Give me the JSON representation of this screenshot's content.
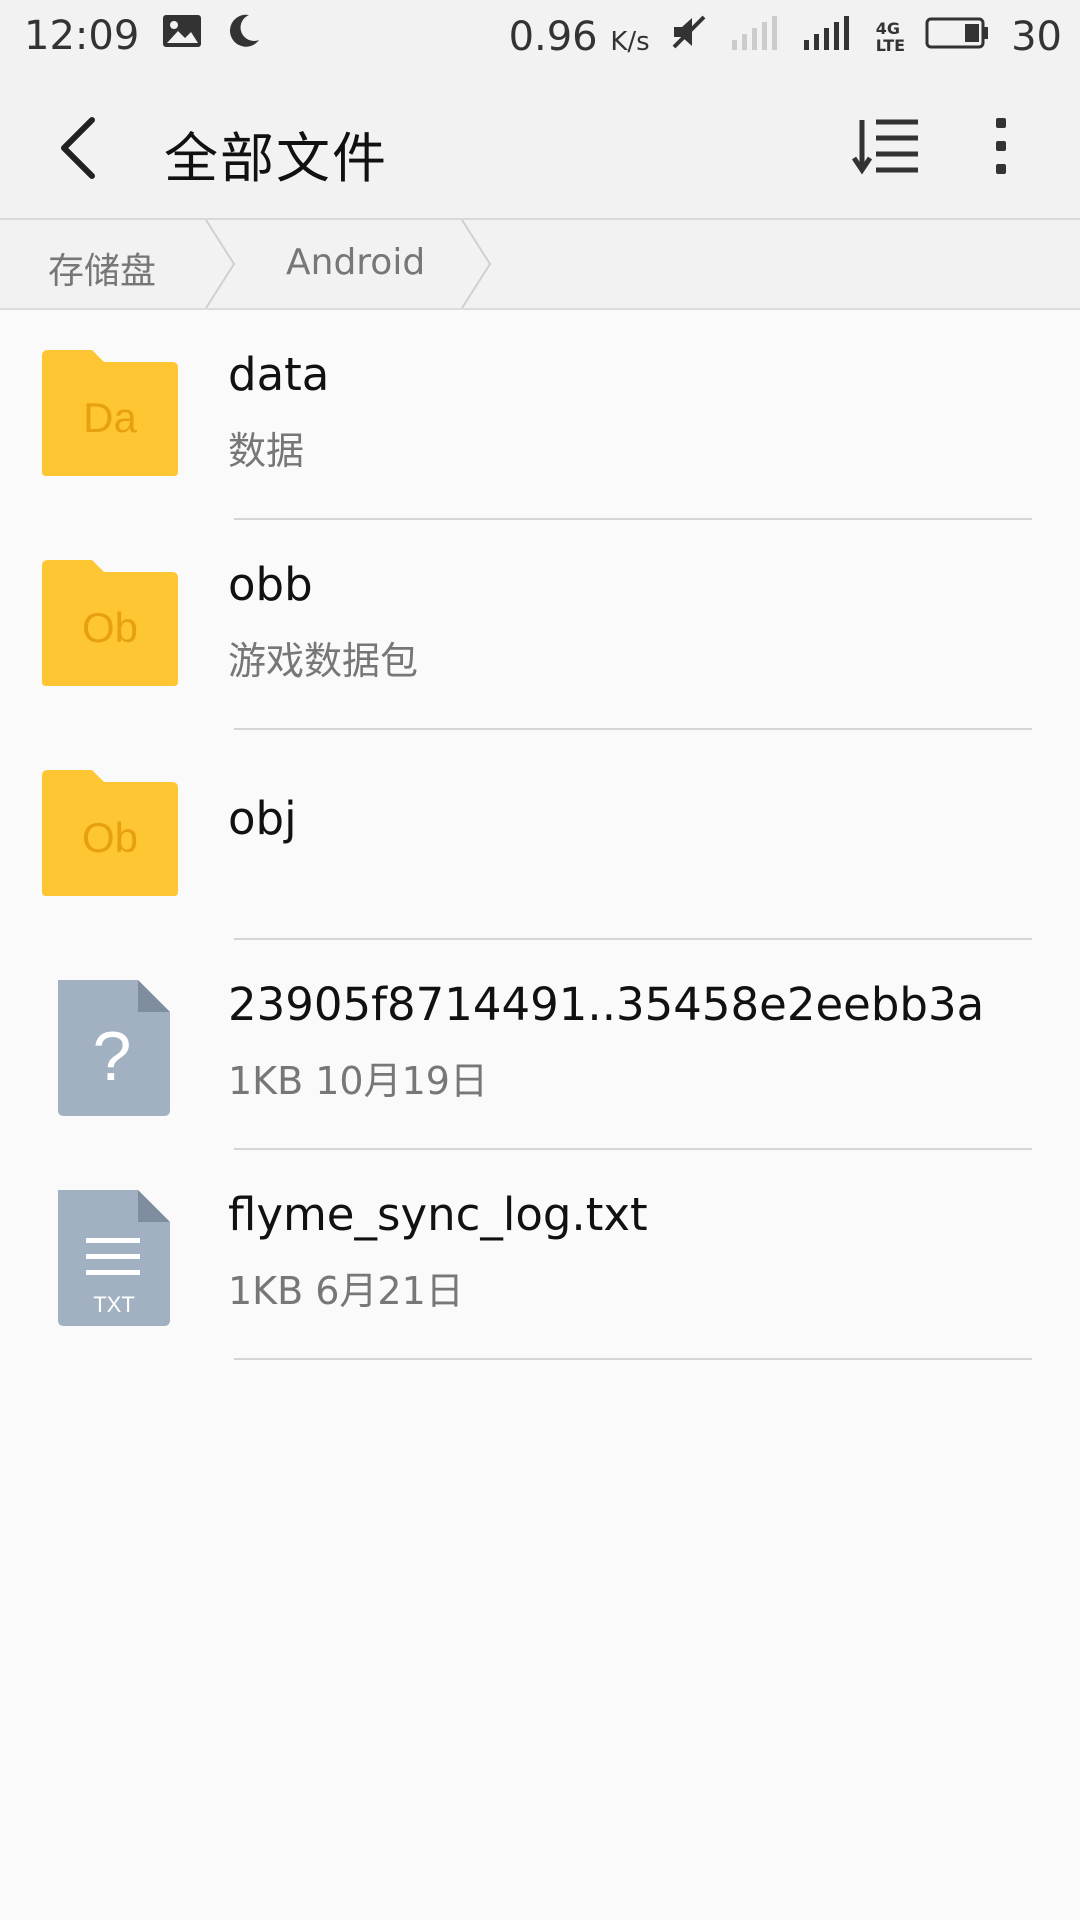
{
  "status_bar": {
    "time": "12:09",
    "net_speed": "0.96",
    "net_unit": "K/s",
    "network_label_top": "4G",
    "network_label_bottom": "LTE",
    "battery_level": "30",
    "icons": [
      "image-icon",
      "moon-icon",
      "mute-icon",
      "signal-empty-icon",
      "signal-full-icon",
      "battery-icon"
    ]
  },
  "app_bar": {
    "title": "全部文件",
    "back_icon": "chevron-left-icon",
    "sort_icon": "sort-icon",
    "more_icon": "more-vert-icon"
  },
  "breadcrumb": {
    "items": [
      "存储盘",
      "Android"
    ]
  },
  "files": [
    {
      "name": "data",
      "sub": "数据",
      "type": "folder",
      "badge": "Da"
    },
    {
      "name": "obb",
      "sub": "游戏数据包",
      "type": "folder",
      "badge": "Ob"
    },
    {
      "name": "obj",
      "sub": "",
      "type": "folder",
      "badge": "Ob"
    },
    {
      "name": "23905f8714491..35458e2eebb3a",
      "sub": "1KB  10月19日",
      "type": "unknown",
      "badge": "?"
    },
    {
      "name": "flyme_sync_log.txt",
      "sub": "1KB  6月21日",
      "type": "txt",
      "badge": "TXT"
    }
  ],
  "colors": {
    "folder": "#FFC633",
    "folder_tab": "#FFC633",
    "folder_text": "#E8A10E",
    "file_icon": "#A2B1C1",
    "file_fold": "#7F8E9E"
  }
}
